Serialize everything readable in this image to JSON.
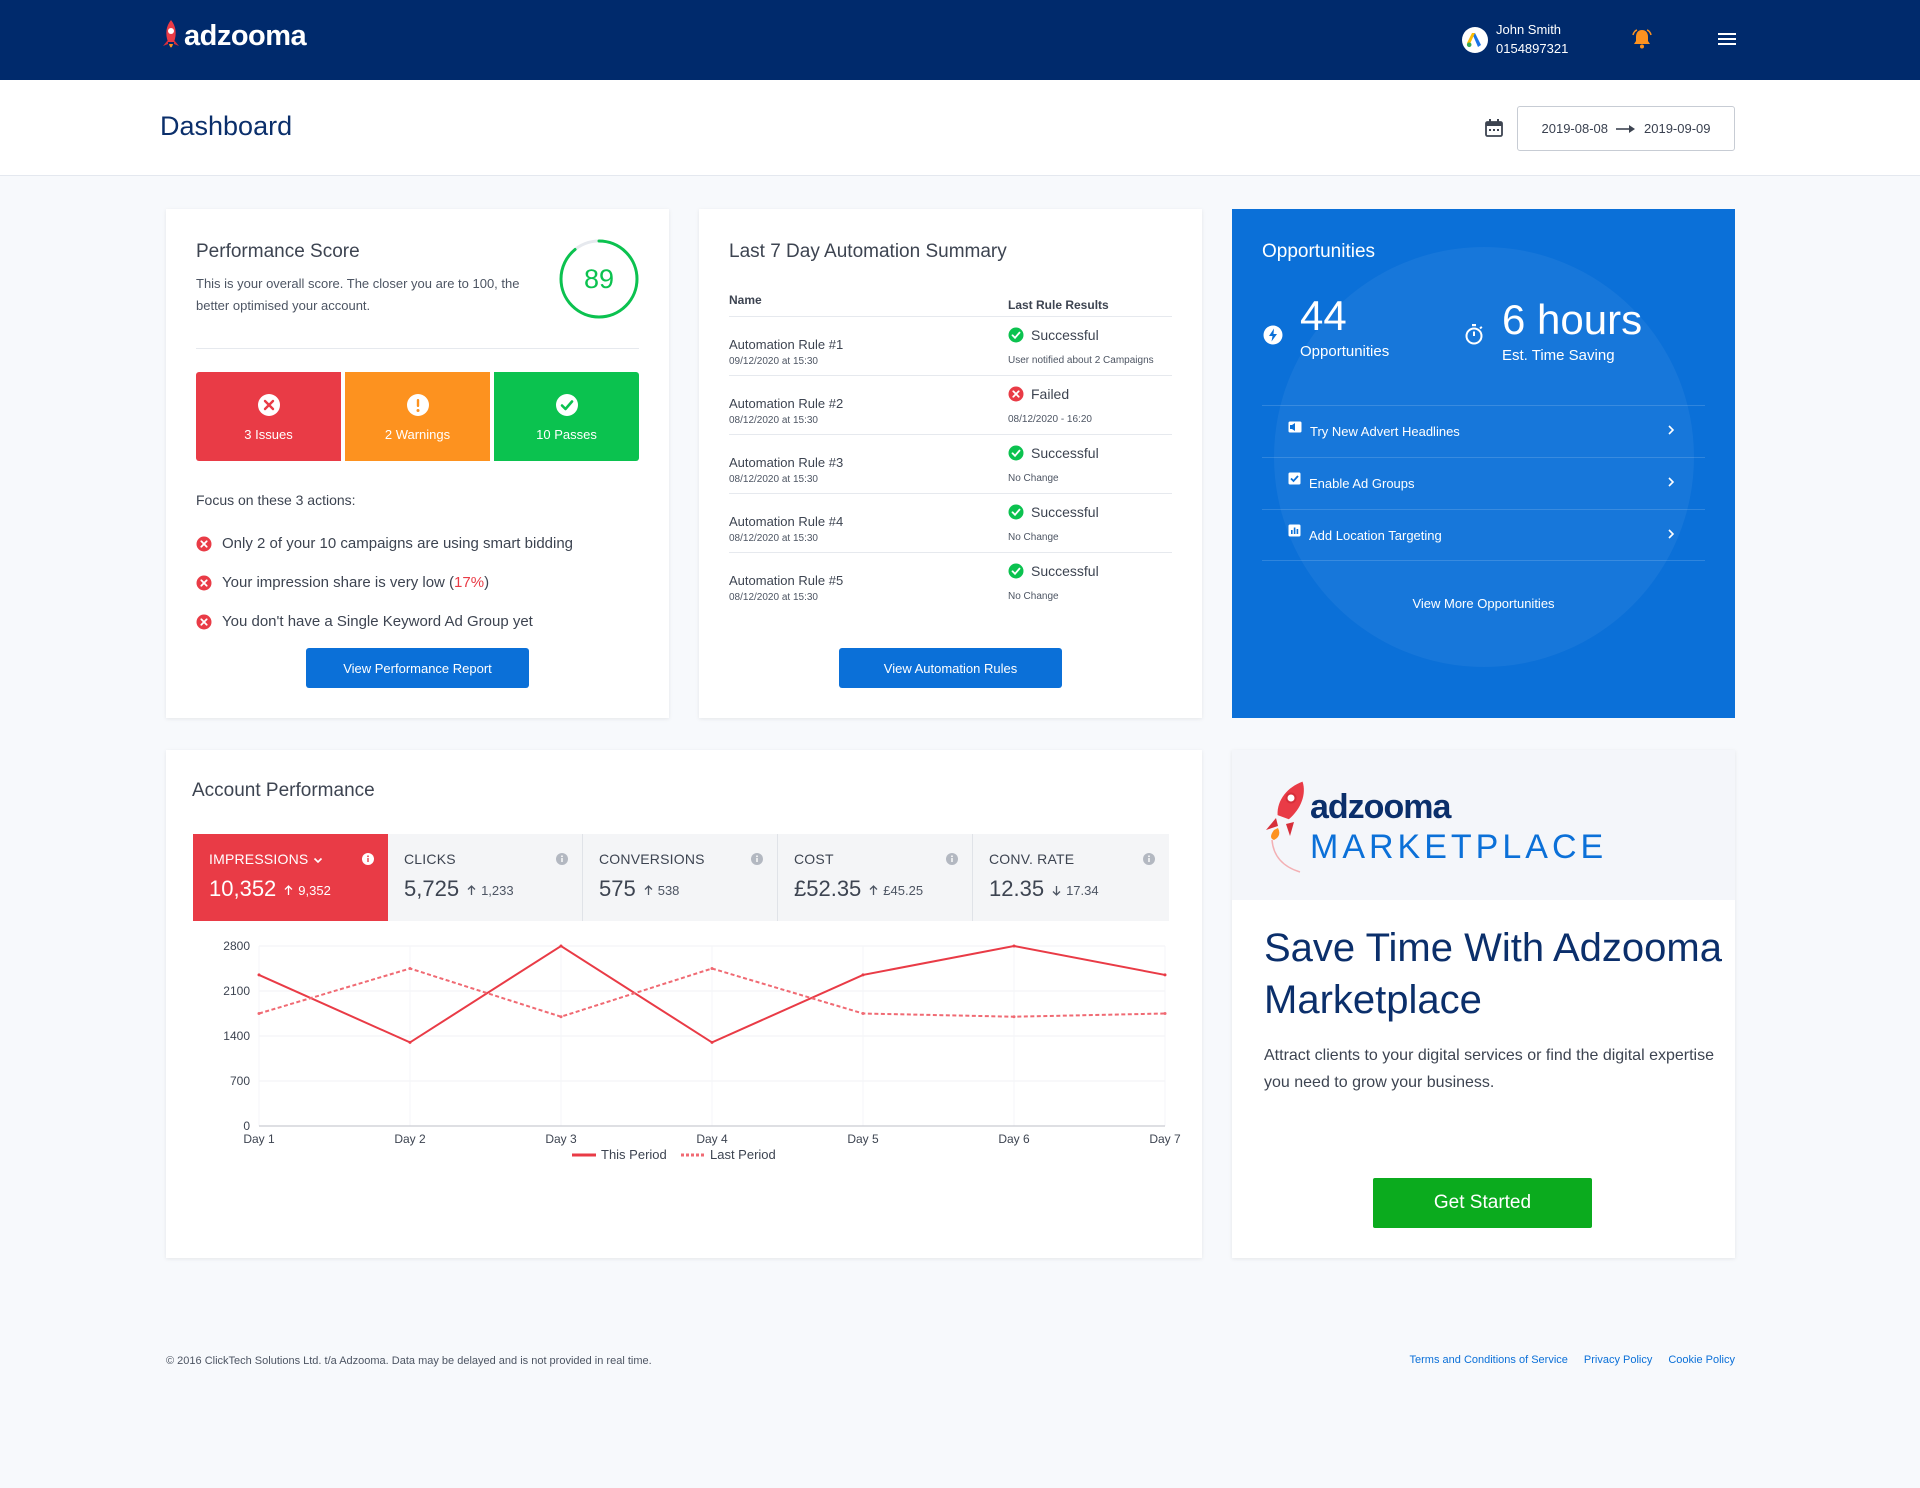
{
  "app": {
    "logo_text": "adzooma",
    "user_name": "John Smith",
    "account_id": "0154897321"
  },
  "header": {
    "title": "Dashboard",
    "date_start": "2019-08-08",
    "date_end": "2019-09-09"
  },
  "performance": {
    "title": "Performance Score",
    "description": "This is your overall score. The closer you are to 100, the better optimised your account.",
    "score": "89",
    "score_value": 89,
    "issues_label": "3 Issues",
    "warnings_label": "2 Warnings",
    "passes_label": "10 Passes",
    "focus_title": "Focus on these 3 actions:",
    "actions": [
      "Only 2 of your 10 campaigns are using smart bidding",
      "Your impression share is very low (",
      "You don't have a Single Keyword Ad Group yet"
    ],
    "impression_share": "17%",
    "paren_close": ")",
    "button": "View Performance Report"
  },
  "automation": {
    "title": "Last 7 Day Automation Summary",
    "col_name": "Name",
    "col_results": "Last Rule Results",
    "rows": [
      {
        "name": "Automation Rule #1",
        "date": "09/12/2020 at 15:30",
        "status": "Successful",
        "note": "User notified about 2 Campaigns"
      },
      {
        "name": "Automation Rule #2",
        "date": "08/12/2020 at 15:30",
        "status": "Failed",
        "note": "08/12/2020 - 16:20"
      },
      {
        "name": "Automation Rule #3",
        "date": "08/12/2020 at 15:30",
        "status": "Successful",
        "note": "No Change"
      },
      {
        "name": "Automation Rule #4",
        "date": "08/12/2020 at 15:30",
        "status": "Successful",
        "note": "No Change"
      },
      {
        "name": "Automation Rule #5",
        "date": "08/12/2020 at 15:30",
        "status": "Successful",
        "note": "No Change"
      }
    ],
    "button": "View Automation Rules"
  },
  "opportunities": {
    "title": "Opportunities",
    "count": "44",
    "count_label": "Opportunities",
    "time": "6 hours",
    "time_label": "Est. Time Saving",
    "items": [
      "Try New Advert Headlines",
      "Enable Ad Groups",
      "Add Location Targeting"
    ],
    "more": "View More Opportunities"
  },
  "account": {
    "title": "Account Performance",
    "metrics": [
      {
        "label": "IMPRESSIONS",
        "value": "10,352",
        "delta": "9,352"
      },
      {
        "label": "CLICKS",
        "value": "5,725",
        "delta": "1,233"
      },
      {
        "label": "CONVERSIONS",
        "value": "575",
        "delta": "538"
      },
      {
        "label": "COST",
        "value": "£52.35",
        "delta": "£45.25"
      },
      {
        "label": "CONV. RATE",
        "value": "12.35",
        "delta": "17.34"
      }
    ]
  },
  "chart_data": {
    "type": "line",
    "x": [
      "Day 1",
      "Day 2",
      "Day 3",
      "Day 4",
      "Day 5",
      "Day 6",
      "Day 7"
    ],
    "y_ticks": [
      "2800",
      "2100",
      "1400",
      "700",
      "0"
    ],
    "ylim": [
      0,
      2800
    ],
    "grid": true,
    "legend": "bottom",
    "series": [
      {
        "name": "This Period",
        "values": [
          2350,
          1300,
          2800,
          1300,
          2350,
          2800,
          2350
        ],
        "color": "#e93b46",
        "dash": false
      },
      {
        "name": "Last Period",
        "values": [
          1750,
          2450,
          1700,
          2450,
          1750,
          1700,
          1750
        ],
        "color": "#f06a73",
        "dash": true
      }
    ]
  },
  "marketplace": {
    "logo_text": "adzooma",
    "logo_sub": "MARKETPLACE",
    "heading": "Save Time With Adzooma Marketplace",
    "text": "Attract clients to your digital services or find the digital expertise you need to grow your business.",
    "button": "Get Started"
  },
  "footer": {
    "copyright": "© 2016 ClickTech Solutions Ltd. t/a Adzooma. Data may be delayed and is not provided in real time.",
    "links": [
      "Terms and Conditions of Service",
      "Privacy Policy",
      "Cookie Policy"
    ]
  },
  "colors": {
    "navy": "#002a6c",
    "blue": "#0b70d8",
    "red": "#e93b46",
    "orange": "#fd921f",
    "green": "#0bc24f",
    "cta_green": "#0bab1e"
  }
}
